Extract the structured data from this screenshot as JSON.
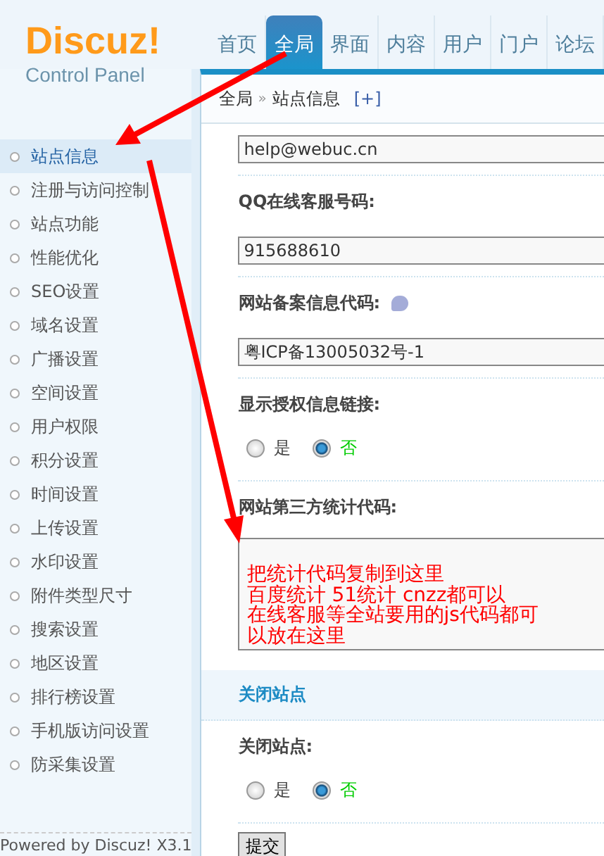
{
  "logo": {
    "title": "Discuz!",
    "subtitle": "Control Panel"
  },
  "nav_tabs": [
    {
      "label": "首页",
      "selected": false
    },
    {
      "label": "全局",
      "selected": true
    },
    {
      "label": "界面",
      "selected": false
    },
    {
      "label": "内容",
      "selected": false
    },
    {
      "label": "用户",
      "selected": false
    },
    {
      "label": "门户",
      "selected": false
    },
    {
      "label": "论坛",
      "selected": false
    }
  ],
  "breadcrumb": {
    "parts": [
      "全局",
      "站点信息"
    ],
    "separator": "»",
    "add": "[+]"
  },
  "sidebar": {
    "items": [
      {
        "label": "站点信息",
        "selected": true
      },
      {
        "label": "注册与访问控制",
        "selected": false
      },
      {
        "label": "站点功能",
        "selected": false
      },
      {
        "label": "性能优化",
        "selected": false
      },
      {
        "label": "SEO设置",
        "selected": false
      },
      {
        "label": "域名设置",
        "selected": false
      },
      {
        "label": "广播设置",
        "selected": false
      },
      {
        "label": "空间设置",
        "selected": false
      },
      {
        "label": "用户权限",
        "selected": false
      },
      {
        "label": "积分设置",
        "selected": false
      },
      {
        "label": "时间设置",
        "selected": false
      },
      {
        "label": "上传设置",
        "selected": false
      },
      {
        "label": "水印设置",
        "selected": false
      },
      {
        "label": "附件类型尺寸",
        "selected": false
      },
      {
        "label": "搜索设置",
        "selected": false
      },
      {
        "label": "地区设置",
        "selected": false
      },
      {
        "label": "排行榜设置",
        "selected": false
      },
      {
        "label": "手机版访问设置",
        "selected": false
      },
      {
        "label": "防采集设置",
        "selected": false
      }
    ],
    "footer": "Powered by Discuz! X3.1"
  },
  "form": [
    {
      "kind": "input",
      "value": "help@webuc.cn"
    },
    {
      "kind": "label",
      "text": "QQ在线客服号码:"
    },
    {
      "kind": "input",
      "value": "915688610"
    },
    {
      "kind": "label",
      "text": "网站备案信息代码:",
      "help": true
    },
    {
      "kind": "input",
      "value": "粤ICP备13005032号-1"
    },
    {
      "kind": "label",
      "text": "显示授权信息链接:"
    },
    {
      "kind": "radio",
      "options": [
        {
          "label": "是",
          "selected": false
        },
        {
          "label": "否",
          "selected": true
        }
      ]
    },
    {
      "kind": "label",
      "text": "网站第三方统计代码:"
    },
    {
      "kind": "textarea",
      "lines": [
        "把统计代码复制到这里",
        "百度统计 51统计 cnzz都可以",
        "在线客服等全站要用的js代码都可",
        "以放在这里"
      ]
    },
    {
      "kind": "section",
      "text": "关闭站点"
    },
    {
      "kind": "label",
      "text": "关闭站点:"
    },
    {
      "kind": "radio",
      "options": [
        {
          "label": "是",
          "selected": false
        },
        {
          "label": "否",
          "selected": true
        }
      ]
    },
    {
      "kind": "submit",
      "text": "提交"
    }
  ]
}
